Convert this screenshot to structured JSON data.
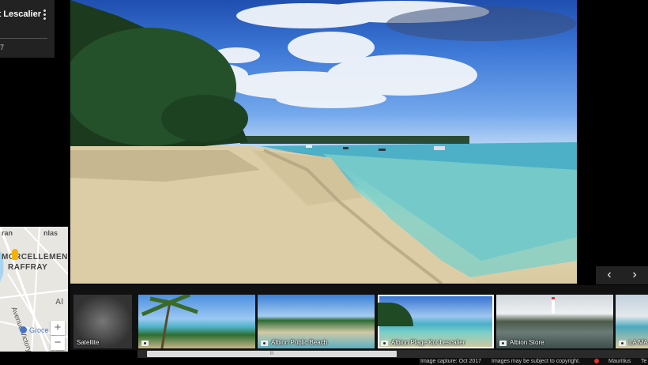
{
  "title_card": {
    "title": "Albion Plage Kot Lescalier",
    "subtitle": "7"
  },
  "minimap": {
    "labels": [
      "ran",
      "nlas",
      "MORCELLEMENT",
      "RAFFRAY",
      "Avenue Victory",
      "Al",
      "Groce"
    ],
    "zoom_in": "+",
    "zoom_out": "−"
  },
  "nav": {
    "prev": "‹",
    "next": "›"
  },
  "filmstrip": {
    "items": [
      {
        "label": "Satellite",
        "camera": false
      },
      {
        "label": "",
        "camera": true
      },
      {
        "label": "Albion Public Beach",
        "camera": true
      },
      {
        "label": "Albion Plage Kot Lescalier",
        "camera": true,
        "selected": true
      },
      {
        "label": "Albion Store",
        "camera": true
      },
      {
        "label": "LA MA",
        "camera": true
      }
    ]
  },
  "scrollbar": {
    "grip": "III"
  },
  "footer": {
    "capture": "Image capture: Oct 2017",
    "copyright": "Images may be subject to copyright.",
    "country": "Mauritius",
    "terms": "Te"
  },
  "colors": {
    "sky": "#3d78d6",
    "sea": "#58b6c9",
    "sand": "#d9caa1",
    "panel": "#222222"
  }
}
